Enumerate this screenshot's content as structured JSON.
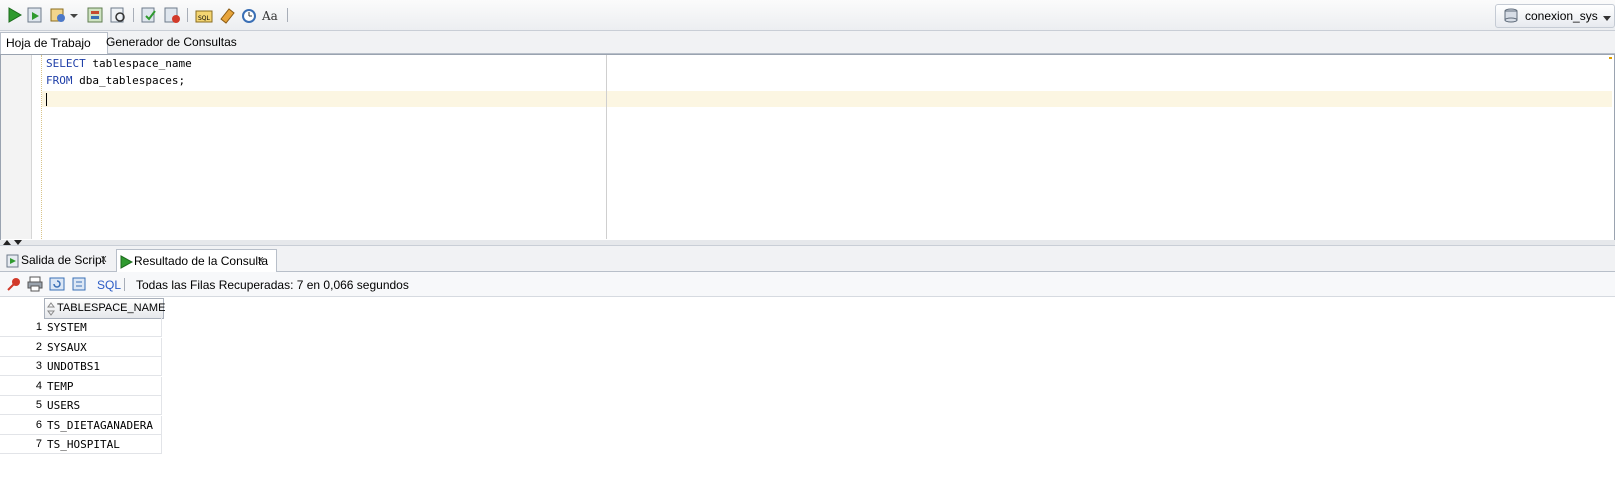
{
  "toolbar": {
    "icons": [
      "run-statement-icon",
      "run-script-icon",
      "autotrace-icon",
      "dropdown-icon",
      "explain-plan-icon",
      "sql-tuning-icon",
      "commit-icon",
      "rollback-icon",
      "unshared-sql-icon",
      "clear-icon",
      "sql-history-icon",
      "format-icon"
    ],
    "connection_label": "conexion_sys"
  },
  "editor_tabs": [
    "Hoja de Trabajo",
    "Generador de Consultas"
  ],
  "editor": {
    "line1_kw": "SELECT",
    "line1_rest": " tablespace_name",
    "line2_kw": "FROM",
    "line2_rest": " dba_tablespaces;"
  },
  "result_tabs": {
    "script_output": "Salida de Script",
    "query_result": "Resultado de la Consulta",
    "close": "x"
  },
  "result_toolbar": {
    "sql_label": "SQL",
    "status": "Todas las Filas Recuperadas: 7 en 0,066 segundos"
  },
  "grid": {
    "column": "TABLESPACE_NAME",
    "rows": [
      {
        "n": "1",
        "v": "SYSTEM"
      },
      {
        "n": "2",
        "v": "SYSAUX"
      },
      {
        "n": "3",
        "v": "UNDOTBS1"
      },
      {
        "n": "4",
        "v": "TEMP"
      },
      {
        "n": "5",
        "v": "USERS"
      },
      {
        "n": "6",
        "v": "TS_DIETAGANADERA"
      },
      {
        "n": "7",
        "v": "TS_HOSPITAL"
      }
    ]
  },
  "colors": {
    "accent_green": "#2f9a2f",
    "keyword_blue": "#1f3fa8"
  }
}
